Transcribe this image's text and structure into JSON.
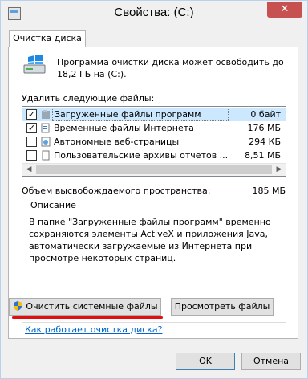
{
  "window": {
    "title": "Свойства: (C:)",
    "close_symbol": "✕"
  },
  "tabs": [
    {
      "label": "Очистка диска",
      "active": true
    }
  ],
  "intro_text": "Программа очистки диска может освободить до 18,2 ГБ на (C:).",
  "list_caption": "Удалить следующие файлы:",
  "files": [
    {
      "checked": true,
      "name": "Загруженные файлы программ",
      "size": "0 байт",
      "icon": "folder-icon",
      "selected": true
    },
    {
      "checked": true,
      "name": "Временные файлы Интернета",
      "size": "176 МБ",
      "icon": "internet-files-icon",
      "selected": false
    },
    {
      "checked": false,
      "name": "Автономные веб-страницы",
      "size": "294 КБ",
      "icon": "web-page-icon",
      "selected": false
    },
    {
      "checked": false,
      "name": "Пользовательские архивы отчетов ...",
      "size": "8,51 МБ",
      "icon": "document-icon",
      "selected": false
    }
  ],
  "space_label": "Объем высвобождаемого пространства:",
  "space_value": "185 МБ",
  "description": {
    "title": "Описание",
    "text": "В папке \"Загруженные файлы программ\" временно сохраняются элементы ActiveX и приложения Java, автоматически загружаемые из Интернета при просмотре некоторых страниц."
  },
  "buttons": {
    "clean_system": "Очистить системные файлы",
    "view_files": "Просмотреть файлы",
    "ok": "OK",
    "cancel": "Отмена"
  },
  "help_link": "Как работает очистка диска?",
  "colors": {
    "accent_red": "#e01010",
    "link": "#0066cc",
    "selection": "#cce8ff"
  }
}
